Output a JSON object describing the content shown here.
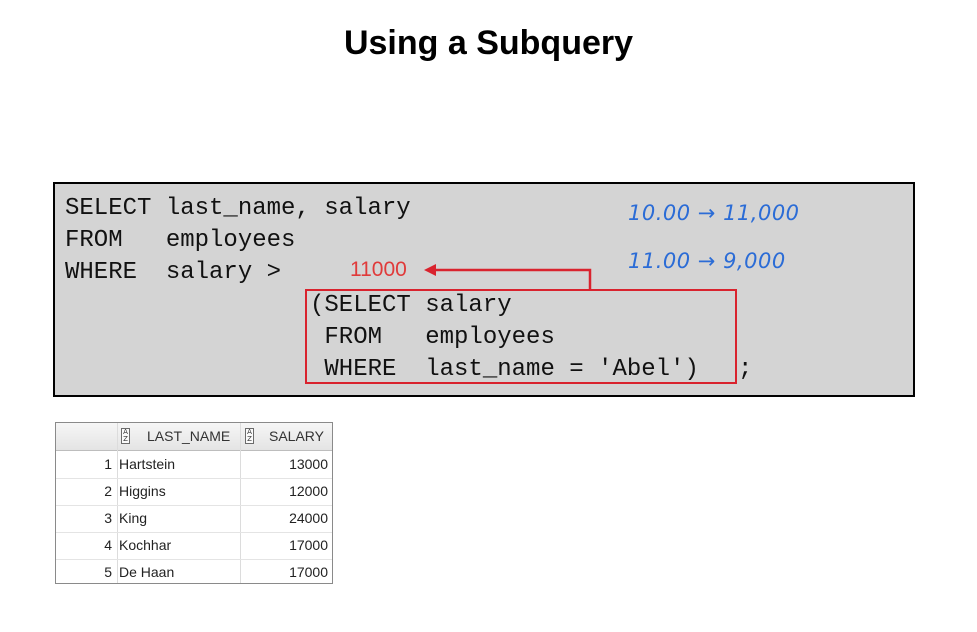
{
  "title": "Using a Subquery",
  "code": {
    "line1": "SELECT last_name, salary",
    "line2": "FROM   employees",
    "line3": "WHERE  salary >",
    "sub1": "(SELECT salary",
    "sub2": " FROM   employees",
    "sub3": " WHERE  last_name = 'Abel')",
    "terminator": ";"
  },
  "subquery_result": "11000",
  "handwritten_notes": [
    "10.00 → 11,000",
    "11.00 → 9,000"
  ],
  "result_grid": {
    "columns": [
      "LAST_NAME",
      "SALARY"
    ],
    "rows": [
      {
        "num": "1",
        "last_name": "Hartstein",
        "salary": "13000"
      },
      {
        "num": "2",
        "last_name": "Higgins",
        "salary": "12000"
      },
      {
        "num": "3",
        "last_name": "King",
        "salary": "24000"
      },
      {
        "num": "4",
        "last_name": "Kochhar",
        "salary": "17000"
      },
      {
        "num": "5",
        "last_name": "De Haan",
        "salary": "17000"
      }
    ]
  },
  "colors": {
    "highlight": "#d9232e",
    "annotation": "#2b6cd6",
    "code_bg": "#d4d4d4"
  }
}
